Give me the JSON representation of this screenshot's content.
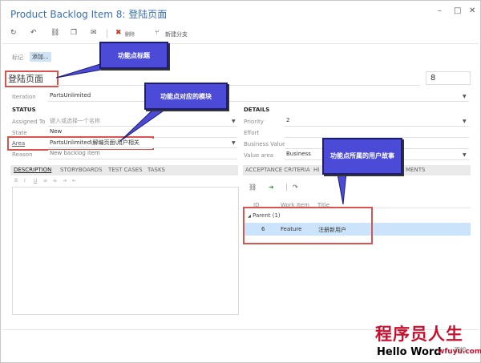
{
  "window": {
    "title": "Product Backlog Item 8: ",
    "title_cn": "登陆页面",
    "minimize_icon": "–",
    "maximize_icon": "□",
    "close_icon": "✕"
  },
  "toolbar": {
    "refresh_icon": "↻",
    "undo_icon": "↶",
    "link_icon": "⛓",
    "copy_icon": "❐",
    "mail_icon": "✉",
    "delete_icon": "✖",
    "delete_label": "删除",
    "branch_icon": "⑂",
    "branch_label": "新建分支"
  },
  "tags": {
    "label": "标记",
    "add_label": "添加..."
  },
  "work_item": {
    "title": "登陆页面",
    "id": "8"
  },
  "iteration": {
    "label": "Iteration",
    "value": "PartsUnlimited"
  },
  "status": {
    "heading": "STATUS",
    "assigned_to": {
      "label": "Assigned To",
      "placeholder": "键入或选择一个名称"
    },
    "state": {
      "label": "State",
      "value": "New"
    },
    "area": {
      "label": "Area",
      "value": "PartsUnlimited\\解编页面\\用户相关"
    },
    "reason": {
      "label": "Reason",
      "value": "New backlog item"
    }
  },
  "details": {
    "heading": "DETAILS",
    "priority": {
      "label": "Priority",
      "value": "2"
    },
    "effort": {
      "label": "Effort",
      "value": ""
    },
    "business_value": {
      "label": "Business Value",
      "value": ""
    },
    "value_area": {
      "label": "Value area",
      "value": "Business"
    }
  },
  "left_tabs": [
    "DESCRIPTION",
    "STORYBOARDS",
    "TEST CASES",
    "TASKS"
  ],
  "editor_toolbar": [
    "B",
    "I",
    "U",
    "≡",
    "≡",
    "⇥",
    "⇤"
  ],
  "right_tabs": [
    "ACCEPTANCE CRITERIA",
    "HI",
    "MENTS"
  ],
  "links": {
    "columns": [
      "ID",
      "Work Item",
      "Title"
    ],
    "group": "Parent (1)",
    "rows": [
      {
        "id": "6",
        "type": "Feature",
        "title": "注册新用户"
      }
    ]
  },
  "callouts": {
    "title_note": "功能点标题",
    "area_note": "功能点对应的模块",
    "story_note": "功能点所属的用户故事"
  },
  "watermark": {
    "cn": "程序员人生",
    "en": "Hello Word",
    "url": "wfuyu.com",
    "suffix": "而知"
  },
  "colors": {
    "accent": "#3a6fb0",
    "highlight": "#d9534f",
    "callout": "#4b4bd8",
    "selected": "#cce4fb"
  }
}
